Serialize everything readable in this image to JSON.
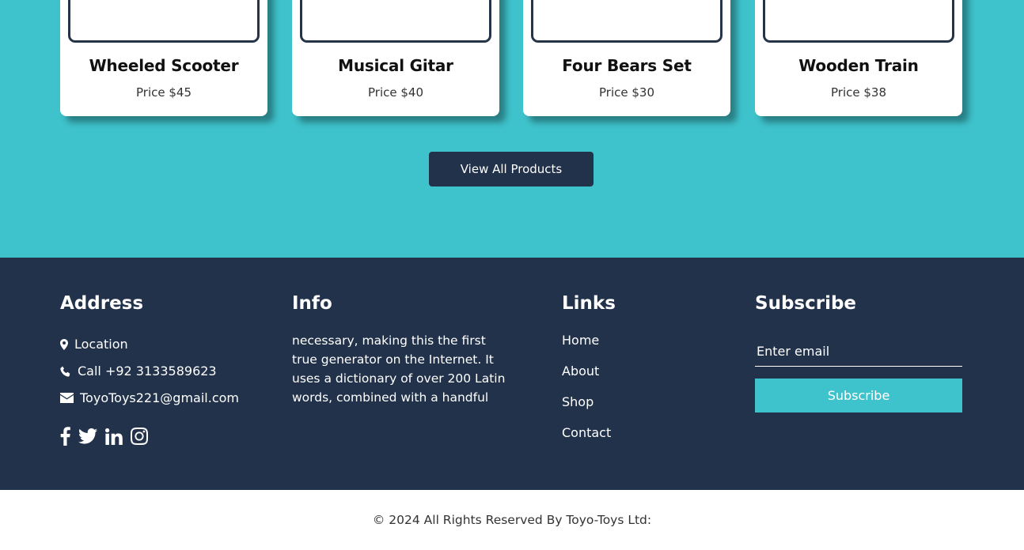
{
  "products": [
    {
      "name": "Wheeled Scooter",
      "price": "Price $45"
    },
    {
      "name": "Musical Gitar",
      "price": "Price $40"
    },
    {
      "name": "Four Bears Set",
      "price": "Price $30"
    },
    {
      "name": "Wooden Train",
      "price": "Price $38"
    }
  ],
  "view_all_label": "View All Products",
  "footer": {
    "address": {
      "heading": "Address",
      "location": "Location",
      "phone": "Call +92 3133589623",
      "email": "ToyoToys221@gmail.com",
      "social_icons": [
        "facebook-icon",
        "twitter-icon",
        "linkedin-icon",
        "instagram-icon"
      ]
    },
    "info": {
      "heading": "Info",
      "text": "necessary, making this the first true generator on the Internet. It uses a dictionary of over 200 Latin words, combined with a handful"
    },
    "links": {
      "heading": "Links",
      "items": [
        "Home",
        "About",
        "Shop",
        "Contact"
      ]
    },
    "subscribe": {
      "heading": "Subscribe",
      "placeholder": "Enter email",
      "button_label": "Subscribe"
    }
  },
  "copyright": "© 2024 All Rights Reserved By Toyo-Toys Ltd:",
  "colors": {
    "accent": "#3ec2cb",
    "dark": "#22324a"
  }
}
